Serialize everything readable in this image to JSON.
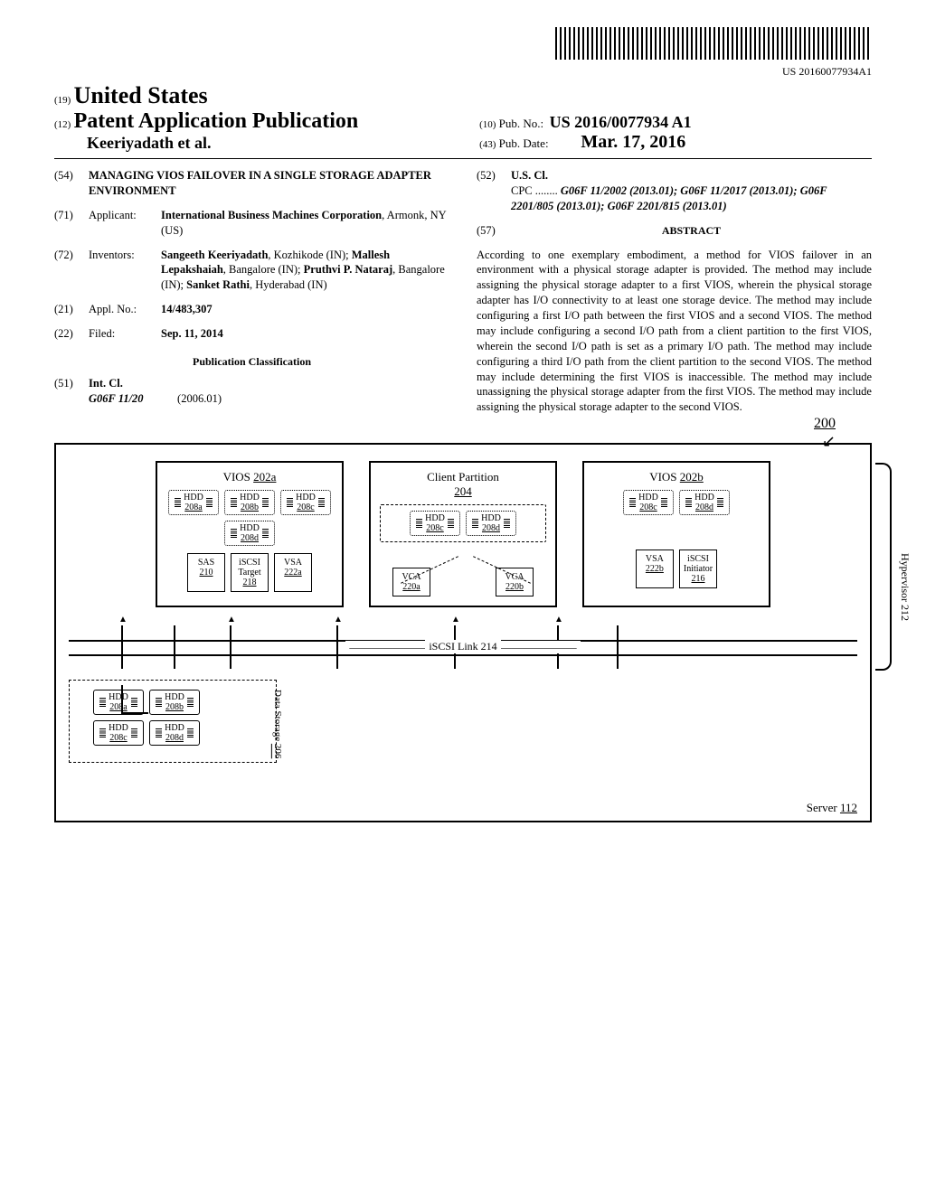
{
  "barcode_number": "US 20160077934A1",
  "header": {
    "code19": "(19)",
    "country": "United States",
    "code12": "(12)",
    "pub_type": "Patent Application Publication",
    "authors": "Keeriyadath et al.",
    "code10": "(10)",
    "pub_no_label": "Pub. No.:",
    "pub_no": "US 2016/0077934 A1",
    "code43": "(43)",
    "pub_date_label": "Pub. Date:",
    "pub_date": "Mar. 17, 2016"
  },
  "bib": {
    "f54": {
      "code": "(54)",
      "text": "MANAGING VIOS FAILOVER IN A SINGLE STORAGE ADAPTER ENVIRONMENT"
    },
    "f71": {
      "code": "(71)",
      "label": "Applicant:",
      "text": "International Business Machines Corporation",
      "loc": ", Armonk, NY (US)"
    },
    "f72": {
      "code": "(72)",
      "label": "Inventors:",
      "inv1": "Sangeeth Keeriyadath",
      "loc1": ", Kozhikode (IN);",
      "inv2": "Mallesh Lepakshaiah",
      "loc2": ", Bangalore (IN);",
      "inv3": "Pruthvi P. Nataraj",
      "loc3": ", Bangalore (IN);",
      "inv4": "Sanket Rathi",
      "loc4": ", Hyderabad (IN)"
    },
    "f21": {
      "code": "(21)",
      "label": "Appl. No.:",
      "val": "14/483,307"
    },
    "f22": {
      "code": "(22)",
      "label": "Filed:",
      "val": "Sep. 11, 2014"
    },
    "pubclass": "Publication Classification",
    "f51": {
      "code": "(51)",
      "label": "Int. Cl.",
      "class": "G06F 11/20",
      "date": "(2006.01)"
    },
    "f52": {
      "code": "(52)",
      "label": "U.S. Cl.",
      "cpc_label": "CPC",
      "cpc": "G06F 11/2002 (2013.01); G06F 11/2017 (2013.01); G06F 2201/805 (2013.01); G06F 2201/815 (2013.01)"
    },
    "f57": {
      "code": "(57)",
      "label": "ABSTRACT"
    },
    "abstract": "According to one exemplary embodiment, a method for VIOS failover in an environment with a physical storage adapter is provided. The method may include assigning the physical storage adapter to a first VIOS, wherein the physical storage adapter has I/O connectivity to at least one storage device. The method may include configuring a first I/O path between the first VIOS and a second VIOS. The method may include configuring a second I/O path from a client partition to the first VIOS, wherein the second I/O path is set as a primary I/O path. The method may include configuring a third I/O path from the client partition to the second VIOS. The method may include determining the first VIOS is inaccessible. The method may include unassigning the physical storage adapter from the first VIOS. The method may include assigning the physical storage adapter to the second VIOS."
  },
  "dia": {
    "fig_no": "200",
    "vios_a": "VIOS 202a",
    "vios_b": "VIOS 202b",
    "client": "Client Partition",
    "client_ref": "204",
    "hdd_a": "HDD",
    "ref_208a": "208a",
    "ref_208b": "208b",
    "ref_208c": "208c",
    "ref_208d": "208d",
    "sas": "SAS",
    "sas_ref": "210",
    "iscsi_t": "iSCSI Target",
    "iscsi_t_ref": "218",
    "vsa": "VSA",
    "vsa_a_ref": "222a",
    "vsa_b_ref": "222b",
    "vca": "VCA",
    "vca_a_ref": "220a",
    "vca_b_ref": "220b",
    "iscsi_i": "iSCSI Initiator",
    "iscsi_i_ref": "216",
    "iscsi_link": "iSCSI Link 214",
    "hypervisor": "Hypervisor 212",
    "storage": "Data Storage",
    "storage_ref": "206",
    "server": "Server 112"
  }
}
